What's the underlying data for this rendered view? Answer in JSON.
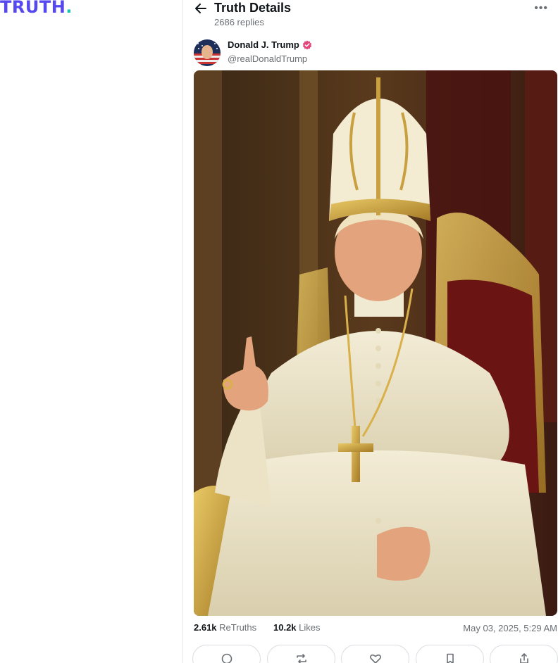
{
  "logo": {
    "text": "TRUTH",
    "dot": "."
  },
  "header": {
    "title": "Truth Details",
    "replies": "2686 replies",
    "more_label": "•••"
  },
  "post": {
    "author_name": "Donald J. Trump",
    "author_handle": "@realDonaldTrump",
    "verified_icon": "verified-badge-icon",
    "media_description_icon": "post-image",
    "stats": {
      "retruths_count": "2.61k",
      "retruths_label": "ReTruths",
      "likes_count": "10.2k",
      "likes_label": "Likes"
    },
    "timestamp": "May 03, 2025, 5:29 AM"
  },
  "actions": [
    {
      "name": "reply",
      "icon": "reply-icon"
    },
    {
      "name": "retruth",
      "icon": "retruth-icon"
    },
    {
      "name": "like",
      "icon": "heart-icon"
    },
    {
      "name": "bookmark",
      "icon": "bookmark-icon"
    },
    {
      "name": "share",
      "icon": "share-icon"
    }
  ],
  "colors": {
    "brand": "#5448ee",
    "brand_dot": "#17c3b2",
    "verified": "#e2457a",
    "muted_text": "#6b6f74",
    "border": "#dadde1"
  }
}
